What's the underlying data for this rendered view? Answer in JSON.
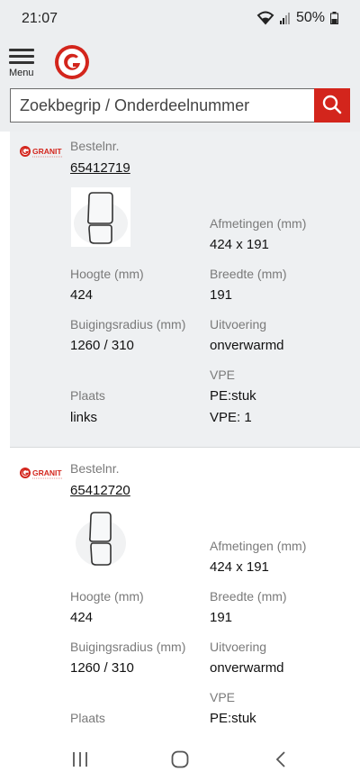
{
  "status_bar": {
    "time": "21:07",
    "battery": "50%"
  },
  "header": {
    "menu_label": "Menu",
    "logo_icon": "granit-g-logo-icon",
    "brand_color": "#d3251c"
  },
  "search": {
    "placeholder": "Zoekbegrip / Onderdeelnummer",
    "button_icon": "search-icon"
  },
  "products": [
    {
      "brand": "GRANIT",
      "order_label": "Bestelnr.",
      "order_number": "65412719",
      "dimensions_label": "Afmetingen (mm)",
      "dimensions_value": "424 x 191",
      "height_label": "Hoogte (mm)",
      "height_value": "424",
      "width_label": "Breedte (mm)",
      "width_value": "191",
      "radius_label": "Buigingsradius (mm)",
      "radius_value": "1260 / 310",
      "version_label": "Uitvoering",
      "version_value": "onverwarmd",
      "vpe_label": "VPE",
      "vpe_unit": "PE:stuk",
      "vpe_value": "VPE: 1",
      "place_label": "Plaats",
      "place_value": "links"
    },
    {
      "brand": "GRANIT",
      "order_label": "Bestelnr.",
      "order_number": "65412720",
      "dimensions_label": "Afmetingen (mm)",
      "dimensions_value": "424 x 191",
      "height_label": "Hoogte (mm)",
      "height_value": "424",
      "width_label": "Breedte (mm)",
      "width_value": "191",
      "radius_label": "Buigingsradius (mm)",
      "radius_value": "1260 / 310",
      "version_label": "Uitvoering",
      "version_value": "onverwarmd",
      "vpe_label": "VPE",
      "vpe_unit": "PE:stuk",
      "place_label": "Plaats"
    }
  ],
  "navigation": {
    "recents_icon": "recents-icon",
    "home_icon": "home-icon",
    "back_icon": "back-icon"
  }
}
